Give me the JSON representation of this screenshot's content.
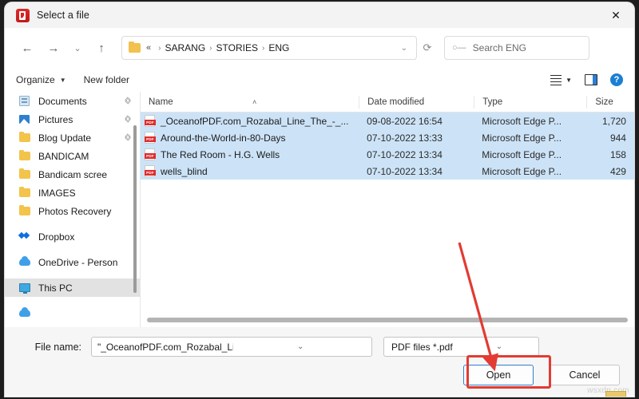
{
  "window": {
    "title": "Select a file",
    "app_icon": "pdf-app-icon",
    "close_label": "✕"
  },
  "nav": {
    "back": "←",
    "forward": "→",
    "recent": "⌄",
    "up": "↑",
    "folder_icon": "folder-icon",
    "crumb_prefix": "«",
    "breadcrumbs": [
      "SARANG",
      "STORIES",
      "ENG"
    ],
    "separator": "›",
    "address_dropdown": "⌄",
    "refresh": "⟳"
  },
  "search": {
    "icon": "search-icon",
    "placeholder": "Search ENG"
  },
  "command_bar": {
    "organize": "Organize",
    "organize_caret": "▼",
    "new_folder": "New folder",
    "view_caret": "▼",
    "preview_pane": "preview-pane-icon",
    "help": "?"
  },
  "sidebar": {
    "items": [
      {
        "label": "Documents",
        "icon": "documents-icon",
        "pinned": true,
        "selected": false,
        "gap": false
      },
      {
        "label": "Pictures",
        "icon": "pictures-icon",
        "pinned": true,
        "selected": false,
        "gap": false
      },
      {
        "label": "Blog Update",
        "icon": "folder-icon",
        "pinned": true,
        "selected": false,
        "gap": false
      },
      {
        "label": "BANDICAM",
        "icon": "folder-icon",
        "pinned": false,
        "selected": false,
        "gap": false
      },
      {
        "label": "Bandicam scree",
        "icon": "folder-icon",
        "pinned": false,
        "selected": false,
        "gap": false
      },
      {
        "label": "IMAGES",
        "icon": "folder-icon",
        "pinned": false,
        "selected": false,
        "gap": false
      },
      {
        "label": "Photos Recovery",
        "icon": "folder-icon",
        "pinned": false,
        "selected": false,
        "gap": false
      },
      {
        "label": "Dropbox",
        "icon": "dropbox-icon",
        "pinned": false,
        "selected": false,
        "gap": true
      },
      {
        "label": "OneDrive - Person",
        "icon": "onedrive-icon",
        "pinned": false,
        "selected": false,
        "gap": true
      },
      {
        "label": "This PC",
        "icon": "this-pc-icon",
        "pinned": false,
        "selected": true,
        "gap": true
      }
    ],
    "pin_glyph": "📌"
  },
  "file_list": {
    "columns": [
      "Name",
      "Date modified",
      "Type",
      "Size"
    ],
    "sort_caret": "˄",
    "rows": [
      {
        "name": "_OceanofPDF.com_Rozabal_Line_The_-_...",
        "date": "09-08-2022 16:54",
        "type": "Microsoft Edge P...",
        "size": "1,720",
        "icon": "pdf-file-icon",
        "selected": true
      },
      {
        "name": "Around-the-World-in-80-Days",
        "date": "07-10-2022 13:33",
        "type": "Microsoft Edge P...",
        "size": "944",
        "icon": "pdf-file-icon",
        "selected": true
      },
      {
        "name": "The Red Room - H.G. Wells",
        "date": "07-10-2022 13:34",
        "type": "Microsoft Edge P...",
        "size": "158",
        "icon": "pdf-file-icon",
        "selected": true
      },
      {
        "name": "wells_blind",
        "date": "07-10-2022 13:34",
        "type": "Microsoft Edge P...",
        "size": "429",
        "icon": "pdf-file-icon",
        "selected": true
      }
    ]
  },
  "footer": {
    "file_name_label": "File name:",
    "file_name_value": "\"_OceanofPDF.com_Rozabal_Line_The_-_Ashwin_Sanghi\" \"Ar",
    "file_name_caret": "⌄",
    "file_type_value": "PDF files *.pdf",
    "file_type_caret": "⌄",
    "open_label": "Open",
    "cancel_label": "Cancel"
  },
  "annotation": {
    "arrow_color": "#e23b33",
    "highlight_color": "#e23b33"
  },
  "watermark": {
    "text": "wsxdn.com"
  }
}
